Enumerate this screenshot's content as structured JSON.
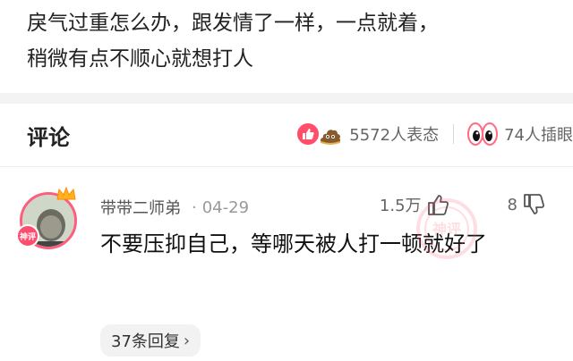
{
  "post": {
    "lines": [
      "戾气过重怎么办，跟发情了一样，一点就着，",
      "稍微有点不顺心就想打人"
    ]
  },
  "comments_section": {
    "title": "评论",
    "reactions": {
      "emote_count": "5572人表态",
      "eye_count": "74人插眼"
    }
  },
  "comment": {
    "author": "带带二师弟",
    "separator": "·",
    "date": "04-29",
    "likes": "1.5万",
    "dislikes": "8",
    "body": "不要压抑自己，等哪天被人打一顿就好了",
    "replies_label": "37条回复",
    "badge_label": "神评",
    "watermark_label": "神评",
    "colors": {
      "accent": "#ff4f6a"
    }
  }
}
